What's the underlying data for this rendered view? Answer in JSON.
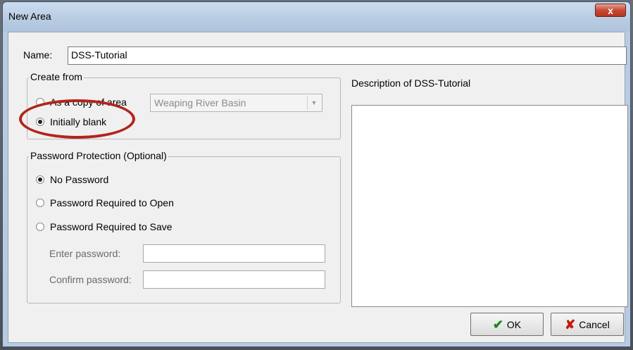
{
  "window": {
    "title": "New Area",
    "close_glyph": "x"
  },
  "name_field": {
    "label": "Name:",
    "value": "DSS-Tutorial"
  },
  "create_from": {
    "legend": "Create from",
    "options": [
      {
        "label": "As a copy of area",
        "selected": false
      },
      {
        "label": "Initially blank",
        "selected": true
      }
    ],
    "copy_area_select": {
      "value": "Weaping River Basin",
      "disabled": true
    }
  },
  "password_protection": {
    "legend": "Password Protection (Optional)",
    "options": [
      {
        "label": "No Password",
        "selected": true
      },
      {
        "label": "Password Required to Open",
        "selected": false
      },
      {
        "label": "Password Required to Save",
        "selected": false
      }
    ],
    "enter_label": "Enter password:",
    "confirm_label": "Confirm password:"
  },
  "description": {
    "label": "Description of DSS-Tutorial",
    "value": ""
  },
  "buttons": {
    "ok": "OK",
    "cancel": "Cancel"
  },
  "colors": {
    "highlight_ring": "#b3241c",
    "ok_icon": "#1c8a1c",
    "cancel_icon": "#c41a10"
  }
}
